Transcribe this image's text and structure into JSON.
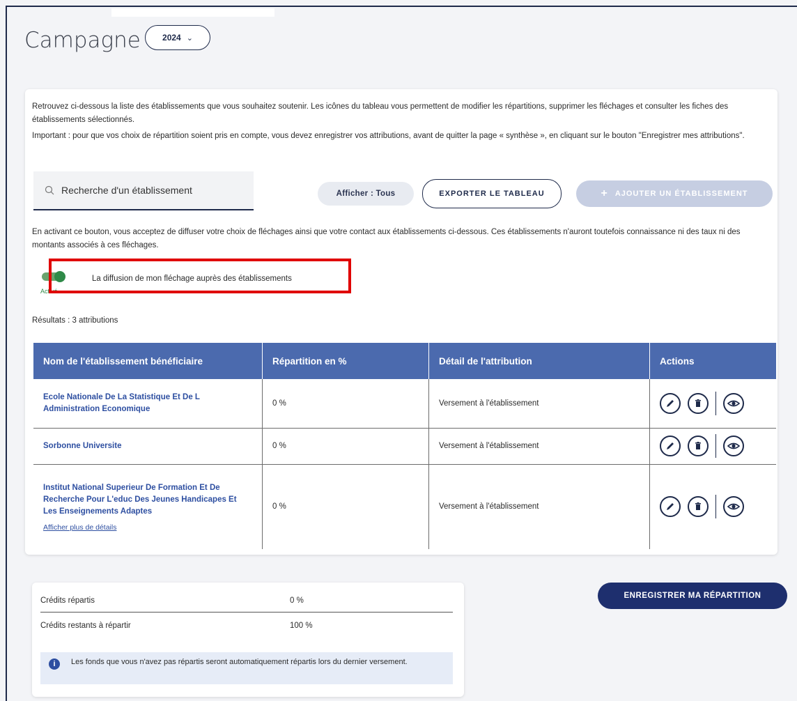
{
  "header": {
    "title": "Campagne",
    "year": "2024",
    "year_chevron": "⌄"
  },
  "intro": {
    "line1": "Retrouvez ci-dessous la liste des établissements que vous souhaitez soutenir. Les icônes du tableau vous permettent de modifier les répartitions, supprimer les fléchages et consulter les fiches des établissements sélectionnés.",
    "line2": "Important : pour que vos choix de répartition soient pris en compte, vous devez enregistrer vos attributions, avant de quitter la page « synthèse », en cliquant sur le bouton \"Enregistrer mes attributions\"."
  },
  "toolbar": {
    "search_placeholder": "Recherche d'un établissement",
    "filter_label": "Afficher : Tous",
    "export_label": "EXPORTER LE TABLEAU",
    "add_label": "AJOUTER UN ÉTABLISSEMENT",
    "add_icon": "+"
  },
  "consent": {
    "text": "En activant ce bouton, vous acceptez de diffuser votre choix de fléchages ainsi que votre contact aux établissements ci-dessous. Ces établissements n'auront toutefois connaissance ni des taux ni des montants associés à ces fléchages.",
    "toggle_state": "Activé",
    "toggle_label": "La diffusion de mon fléchage auprès des établissements"
  },
  "results": "Résultats : 3 attributions",
  "table": {
    "headers": [
      "Nom de l'établissement bénéficiaire",
      "Répartition en %",
      "Détail de l'attribution",
      "Actions"
    ],
    "rows": [
      {
        "name": "Ecole Nationale De La Statistique Et De L Administration Economique",
        "pct": "0 %",
        "detail": "Versement à l'établissement"
      },
      {
        "name": "Sorbonne Universite",
        "pct": "0 %",
        "detail": "Versement à l'établissement"
      },
      {
        "name": "Institut National Superieur De Formation Et De Recherche Pour L'educ Des Jeunes Handicapes Et Les Enseignements Adaptes",
        "pct": "0 %",
        "detail": "Versement à l'établissement",
        "more": "Afficher plus de détails"
      }
    ]
  },
  "credits": {
    "row1_label": "Crédits répartis",
    "row1_value": "0 %",
    "row2_label": "Crédits restants à répartir",
    "row2_value": "100 %",
    "info_icon": "i",
    "info_text": "Les fonds que vous n'avez pas répartis seront automatiquement répartis lors du dernier versement."
  },
  "save_label": "ENREGISTRER MA RÉPARTITION",
  "colors": {
    "primary": "#1e2f6e",
    "table_header": "#4b6aae",
    "toggle_on": "#2f8a48",
    "highlight": "#e00000"
  }
}
